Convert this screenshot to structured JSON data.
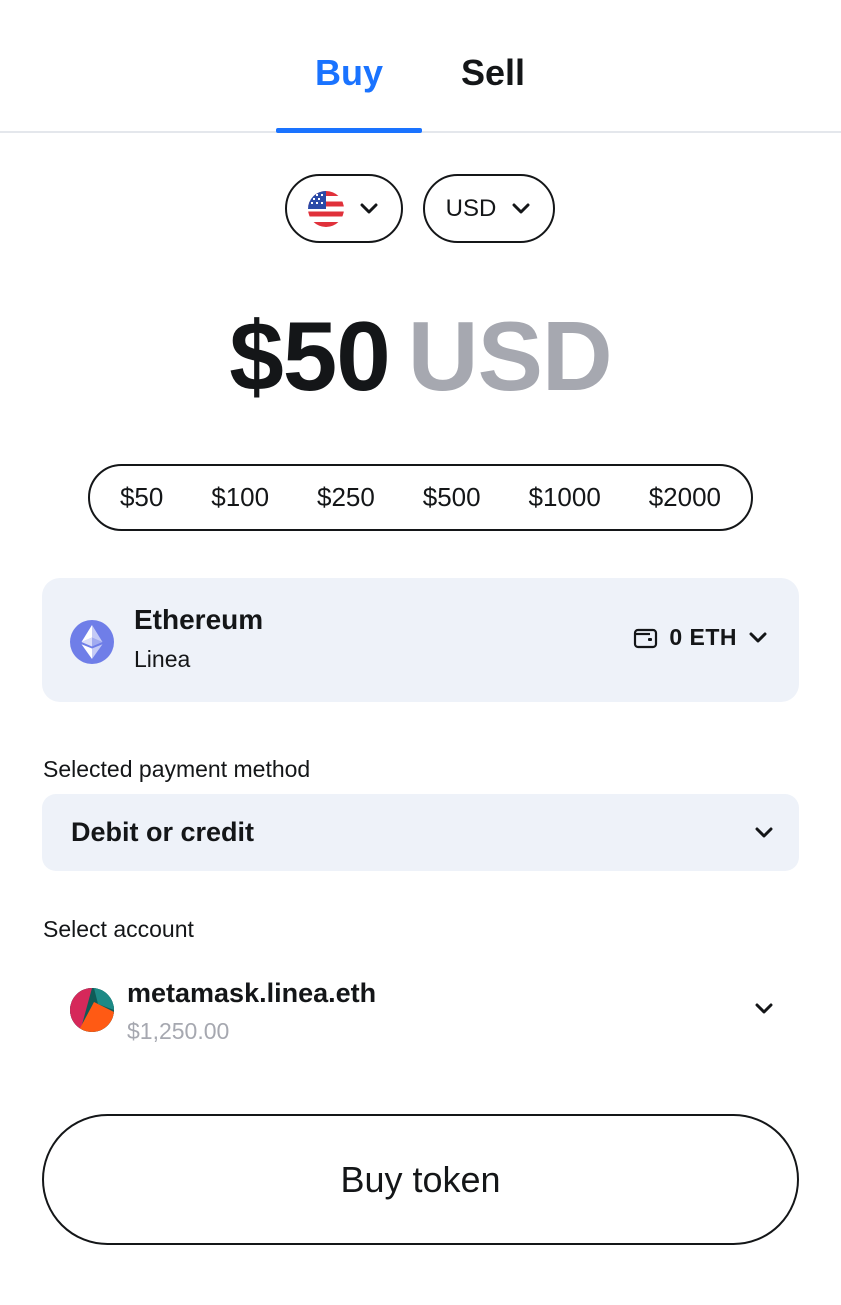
{
  "tabs": [
    {
      "label": "Buy",
      "active": true
    },
    {
      "label": "Sell",
      "active": false
    }
  ],
  "region": {
    "selected_icon": "us-flag-icon"
  },
  "currency": {
    "selected": "USD"
  },
  "amount": {
    "value": "$50",
    "currency": "USD"
  },
  "quick_amounts": [
    "$50",
    "$100",
    "$250",
    "$500",
    "$1000",
    "$2000"
  ],
  "token": {
    "name": "Ethereum",
    "network": "Linea",
    "icon": "ethereum-icon",
    "balance": "0 ETH"
  },
  "payment": {
    "label": "Selected payment method",
    "selected": "Debit or credit"
  },
  "account": {
    "label": "Select account",
    "name": "metamask.linea.eth",
    "balance": "$1,250.00"
  },
  "buy_button": {
    "label": "Buy token"
  },
  "colors": {
    "accent": "#1a73ff",
    "muted": "#a6a8b0",
    "card_bg": "#eef2f9",
    "text": "#141618"
  }
}
